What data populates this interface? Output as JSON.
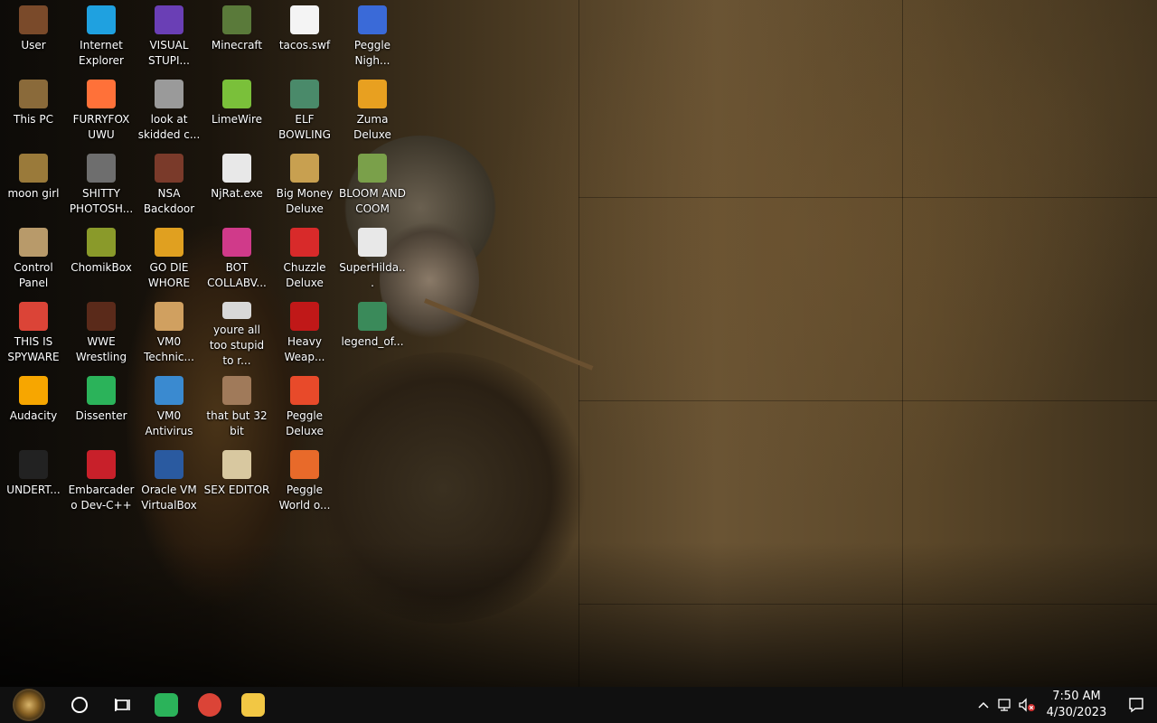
{
  "desktop": {
    "icons": [
      {
        "label": "User",
        "icon": "user-folder-icon",
        "color": "#7a4a2a"
      },
      {
        "label": "This PC",
        "icon": "this-pc-icon",
        "color": "#8a6a3a"
      },
      {
        "label": "moon girl",
        "icon": "moon-girl-icon",
        "color": "#9a7a3a"
      },
      {
        "label": "Control Panel",
        "icon": "control-panel-icon",
        "color": "#b89a6a"
      },
      {
        "label": "THIS IS SPYWARE",
        "icon": "chrome-icon",
        "color": "#db4437"
      },
      {
        "label": "Audacity",
        "icon": "audacity-icon",
        "color": "#f7a600"
      },
      {
        "label": "UNDERT...",
        "icon": "unity-icon",
        "color": "#222222"
      },
      {
        "label": "Internet Explorer",
        "icon": "edge-icon",
        "color": "#1fa1e0"
      },
      {
        "label": "FURRYFOX UWU",
        "icon": "firefox-icon",
        "color": "#ff7139"
      },
      {
        "label": "SHITTY PHOTOSH...",
        "icon": "gimp-icon",
        "color": "#6e6e6e"
      },
      {
        "label": "ChomikBox",
        "icon": "chomikbox-icon",
        "color": "#8a9a2a"
      },
      {
        "label": "WWE Wrestling",
        "icon": "wwe-icon",
        "color": "#5a2a1a"
      },
      {
        "label": "Dissenter",
        "icon": "dissenter-icon",
        "color": "#2bb35a"
      },
      {
        "label": "Embarcadero Dev-C++",
        "icon": "devcpp-icon",
        "color": "#c8202a"
      },
      {
        "label": "VISUAL STUPI...",
        "icon": "visual-studio-icon",
        "color": "#6a3fb5"
      },
      {
        "label": "look at skidded c...",
        "icon": "copy-icon",
        "color": "#9a9a9a"
      },
      {
        "label": "NSA Backdoor",
        "icon": "nsa-icon",
        "color": "#7a3a2a"
      },
      {
        "label": "GO DIE WHORE",
        "icon": "de-app-icon",
        "color": "#e0a020"
      },
      {
        "label": "VM0 Technic...",
        "icon": "vm0-technic-icon",
        "color": "#d0a060"
      },
      {
        "label": "VM0 Antivirus",
        "icon": "shield-icon",
        "color": "#3a8ad0"
      },
      {
        "label": "Oracle VM VirtualBox",
        "icon": "virtualbox-icon",
        "color": "#2a5aa0"
      },
      {
        "label": "Minecraft",
        "icon": "minecraft-icon",
        "color": "#5a7a3a"
      },
      {
        "label": "LimeWire",
        "icon": "limewire-icon",
        "color": "#7ac03a"
      },
      {
        "label": "NjRat.exe",
        "icon": "skull-icon",
        "color": "#e8e8e8"
      },
      {
        "label": "BOT COLLABV...",
        "icon": "bot-collab-icon",
        "color": "#d03a8a"
      },
      {
        "label": "youre all too stupid to r...",
        "icon": "portrait-icon",
        "color": "#d8d8d8"
      },
      {
        "label": "that but 32 bit",
        "icon": "painting-icon",
        "color": "#a07a5a"
      },
      {
        "label": "SEX EDITOR",
        "icon": "xd-icon",
        "color": "#d8c8a0"
      },
      {
        "label": "tacos.swf",
        "icon": "flash-file-icon",
        "color": "#f4f4f4"
      },
      {
        "label": "ELF BOWLING",
        "icon": "elf-bowling-icon",
        "color": "#4a8a6a"
      },
      {
        "label": "Big Money Deluxe",
        "icon": "money-bag-icon",
        "color": "#c8a050"
      },
      {
        "label": "Chuzzle Deluxe",
        "icon": "chuzzle-icon",
        "color": "#d82a2a"
      },
      {
        "label": "Heavy Weap...",
        "icon": "heavy-weapon-icon",
        "color": "#c01818"
      },
      {
        "label": "Peggle Deluxe",
        "icon": "peggle-icon",
        "color": "#e84a2a"
      },
      {
        "label": "Peggle World o...",
        "icon": "peggle-world-icon",
        "color": "#e86a2a"
      },
      {
        "label": "Peggle Nigh...",
        "icon": "peggle-nights-icon",
        "color": "#3a6ad8"
      },
      {
        "label": "Zuma Deluxe",
        "icon": "zuma-icon",
        "color": "#e8a020"
      },
      {
        "label": "BLOOM AND COOM",
        "icon": "bloom-icon",
        "color": "#7aa04a"
      },
      {
        "label": "SuperHilda...",
        "icon": "superhilda-icon",
        "color": "#e8e8e8"
      },
      {
        "label": "legend_of...",
        "icon": "legend-icon",
        "color": "#3a8a5a"
      }
    ]
  },
  "taskbar": {
    "clock": {
      "time": "7:50 AM",
      "date": "4/30/2023"
    },
    "pinned": [
      {
        "name": "dissenter",
        "color": "#2bb35a"
      },
      {
        "name": "chrome",
        "color": "#db4437"
      },
      {
        "name": "file-explorer",
        "color": "#f2c744"
      }
    ]
  }
}
